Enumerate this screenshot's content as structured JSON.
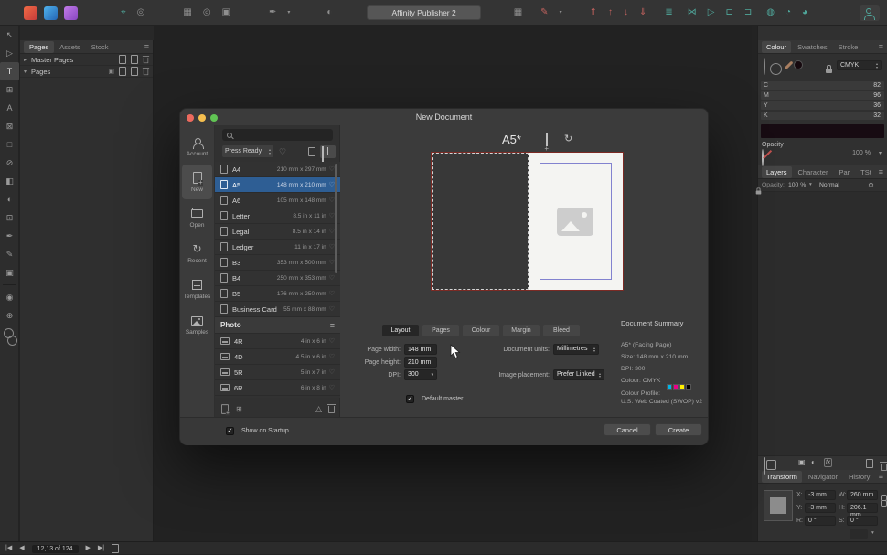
{
  "app": {
    "title": "Affinity Publisher 2"
  },
  "colors": {
    "selection_blue": "#2e5e94",
    "bleed_red": "#7c2a24",
    "margin_blue": "#8282cf",
    "cmyk_swatches": {
      "cyan": "#00b6e8",
      "magenta": "#eb008b",
      "yellow": "#fff000",
      "black": "#000000"
    },
    "app_icons": {
      "publisher": "#d8453f",
      "photo": "#2f8fd4",
      "designer": "#9c5fd0"
    }
  },
  "left_panel": {
    "tabs": [
      "Pages",
      "Assets",
      "Stock"
    ],
    "master_pages_label": "Master Pages",
    "pages_label": "Pages"
  },
  "status_bar": {
    "page_indicator": "12,13 of 124"
  },
  "dialog": {
    "title": "New Document",
    "sidebar": [
      "Account",
      "New",
      "Open",
      "Recent",
      "Templates",
      "Samples"
    ],
    "presets": {
      "category": "Press Ready",
      "section_label": "Photo",
      "items": [
        {
          "name": "A4",
          "size": "210 mm x 297 mm"
        },
        {
          "name": "A5",
          "size": "148 mm x 210 mm"
        },
        {
          "name": "A6",
          "size": "105 mm x 148 mm"
        },
        {
          "name": "Letter",
          "size": "8.5 in x 11 in"
        },
        {
          "name": "Legal",
          "size": "8.5 in x 14 in"
        },
        {
          "name": "Ledger",
          "size": "11 in x 17 in"
        },
        {
          "name": "B3",
          "size": "353 mm x 500 mm"
        },
        {
          "name": "B4",
          "size": "250 mm x 353 mm"
        },
        {
          "name": "B5",
          "size": "176 mm x 250 mm"
        },
        {
          "name": "Business Card",
          "size": "55 mm x 88 mm"
        }
      ],
      "photo_items": [
        {
          "name": "4R",
          "size": "4 in x 6 in"
        },
        {
          "name": "4D",
          "size": "4.5 in x 6 in"
        },
        {
          "name": "5R",
          "size": "5 in x 7 in"
        },
        {
          "name": "6R",
          "size": "6 in x 8 in"
        }
      ]
    },
    "preview": {
      "title": "A5*"
    },
    "tabs": [
      "Layout",
      "Pages",
      "Colour",
      "Margin",
      "Bleed"
    ],
    "form": {
      "page_width_label": "Page width:",
      "page_width": "148 mm",
      "page_height_label": "Page height:",
      "page_height": "210 mm",
      "dpi_label": "DPI:",
      "dpi": "300",
      "units_label": "Document units:",
      "units": "Millimetres",
      "placement_label": "Image placement:",
      "placement": "Prefer Linked",
      "default_master_label": "Default master"
    },
    "summary": {
      "title": "Document Summary",
      "type": "A5* (Facing Page)",
      "size": "Size: 148 mm x 210 mm",
      "dpi": "DPI:  300",
      "colour": "Colour: CMYK",
      "profile_label": "Colour Profile:",
      "profile": "U.S. Web Coated (SWOP) v2"
    },
    "footer": {
      "show_on_startup": "Show on Startup",
      "cancel": "Cancel",
      "create": "Create"
    }
  },
  "colour_panel": {
    "tabs": [
      "Colour",
      "Swatches",
      "Stroke"
    ],
    "mode": "CMYK",
    "channels": [
      {
        "label": "C",
        "value": "82"
      },
      {
        "label": "M",
        "value": "96"
      },
      {
        "label": "Y",
        "value": "36"
      },
      {
        "label": "K",
        "value": "32"
      }
    ],
    "opacity_label": "Opacity",
    "opacity_value": "100 %"
  },
  "layers_panel": {
    "tabs": [
      "Layers",
      "Character",
      "Par",
      "TSt"
    ],
    "opacity_label": "Opacity:",
    "opacity_value": "100 %",
    "blend_mode": "Normal"
  },
  "transform_panel": {
    "tabs": [
      "Transform",
      "Navigator",
      "History"
    ],
    "fields": [
      {
        "label": "X:",
        "value": "-3 mm"
      },
      {
        "label": "Y:",
        "value": "-3 mm"
      },
      {
        "label": "W:",
        "value": "260 mm"
      },
      {
        "label": "H:",
        "value": "206.1 mm"
      },
      {
        "label": "R:",
        "value": "0 °"
      },
      {
        "label": "S:",
        "value": "0 °"
      }
    ]
  },
  "icons": {
    "heart": "♡",
    "menu": "≡",
    "menu_dots": "⋮",
    "chevron_down": "▾",
    "chevron_up": "▴",
    "disclosure_closed": "▸",
    "disclosure_open": "▾",
    "check": "✓",
    "rotate": "↻",
    "warning": "△",
    "prev": "◀",
    "next": "▶",
    "first": "|◀",
    "last": "▶|",
    "gear": "⚙",
    "snap": "⌖",
    "circle": "◎",
    "pen_nib": "✒",
    "pencil": "✎",
    "move": "↖",
    "node": "▷",
    "letter_t": "T",
    "letter_a": "A",
    "table": "⊞",
    "shape": "□",
    "picture_frame": "⊠",
    "ellipse_frame": "⊘",
    "fill": "◧",
    "transparency": "◐",
    "crop": "⊡",
    "zoom": "⊕",
    "view": "◉",
    "align": "≣",
    "flip_h": "⋈",
    "insert_left": "⊏",
    "insert_right": "⊐",
    "front": "⇑",
    "up": "↑",
    "down": "↓",
    "back": "⇓",
    "geo_add": "◍",
    "geo_subtract": "◔",
    "geo_intersect": "◕",
    "grid": "▦",
    "dot_grid": "▣",
    "plus": "+",
    "fx": "fx"
  }
}
